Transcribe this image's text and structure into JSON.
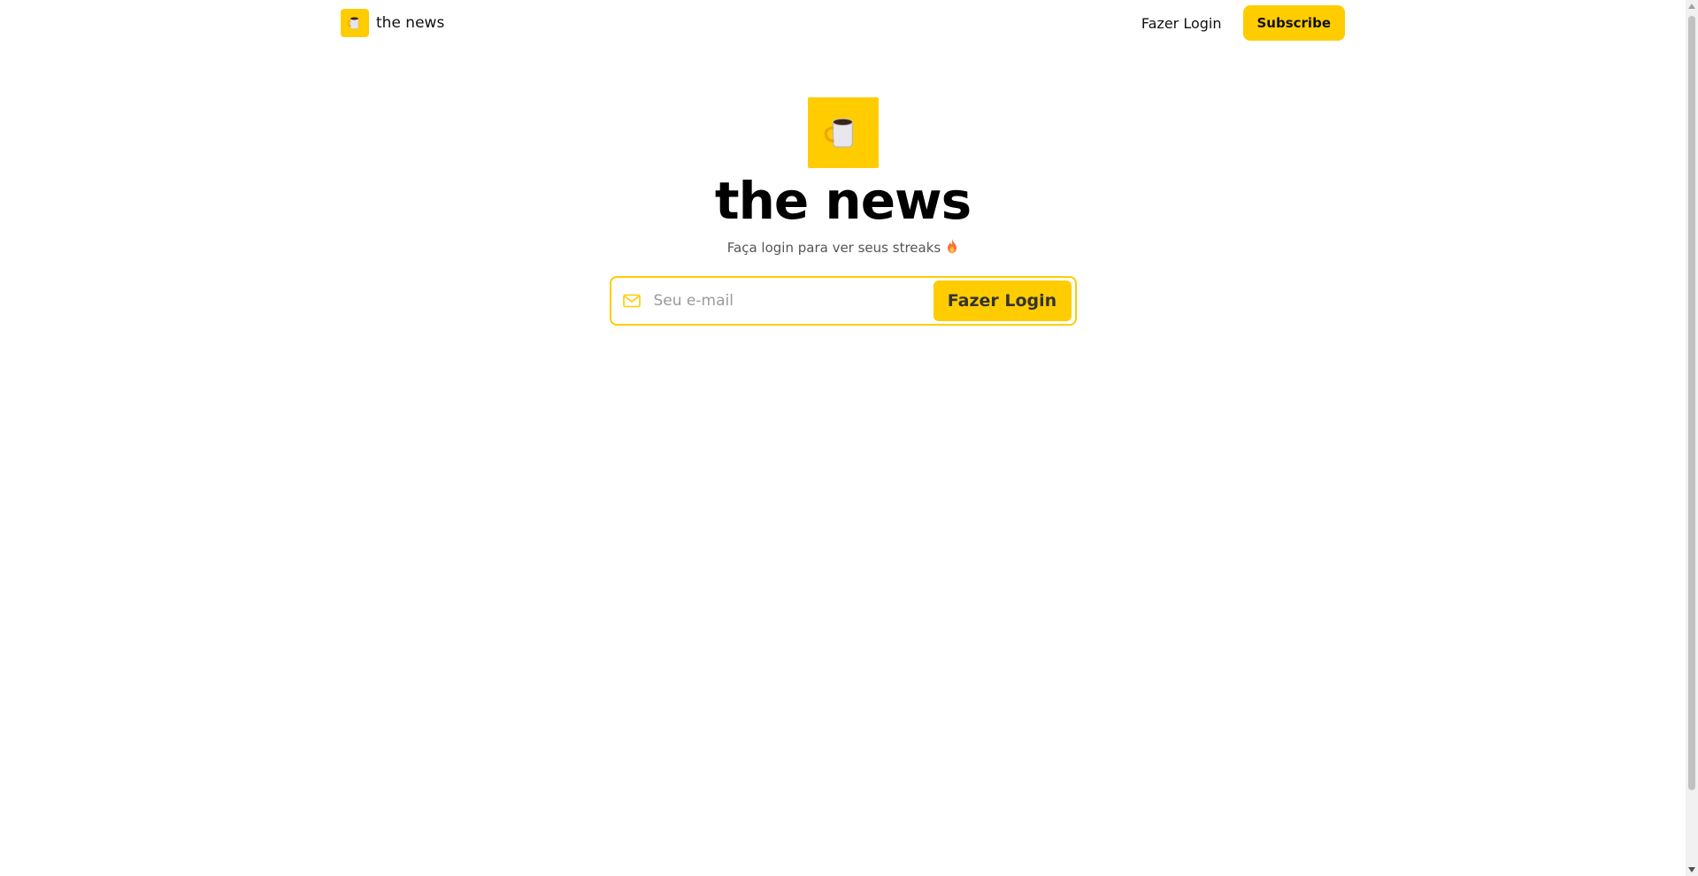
{
  "header": {
    "brand_name": "the news",
    "login_link": "Fazer Login",
    "subscribe_label": "Subscribe"
  },
  "hero": {
    "title": "the news",
    "subtitle": "Faça login para ver seus streaks",
    "subtitle_emoji": "fire-icon"
  },
  "login_form": {
    "email_placeholder": "Seu e-mail",
    "email_value": "",
    "submit_label": "Fazer Login"
  },
  "icons": {
    "logo": "coffee-mug-icon",
    "email": "mail-icon"
  },
  "colors": {
    "accent": "#ffcc00",
    "text": "#111111",
    "muted": "#555555",
    "placeholder": "#9a9a9a"
  }
}
